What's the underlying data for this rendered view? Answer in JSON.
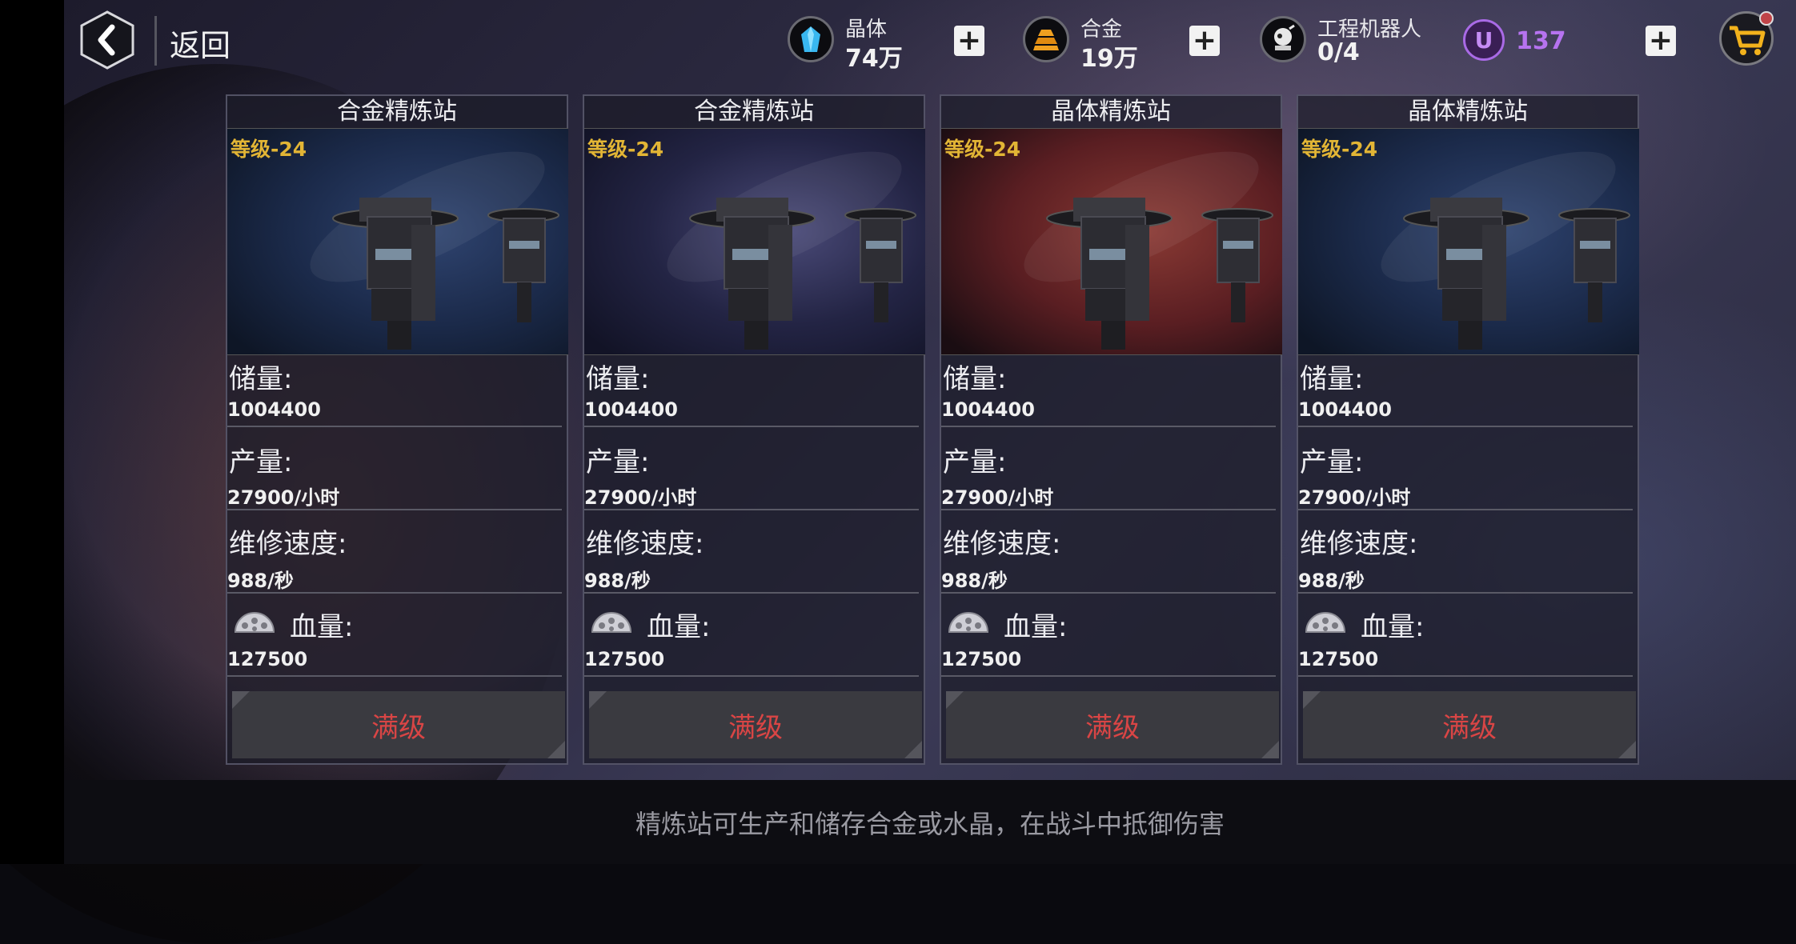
{
  "header": {
    "back_label": "返回",
    "resources": [
      {
        "name": "晶体",
        "value": "74万",
        "icon": "crystal-icon"
      },
      {
        "name": "合金",
        "value": "19万",
        "icon": "alloy-icon"
      },
      {
        "name": "工程机器人",
        "value": "0/4",
        "icon": "robot-icon"
      }
    ],
    "premium": {
      "icon_letter": "U",
      "value": "137"
    }
  },
  "cards": [
    {
      "title": "合金精炼站",
      "level": "等级-24",
      "image_theme": "blue-nebula",
      "storage_label": "储量:",
      "storage_value": "1004400",
      "output_label": "产量:",
      "output_value": "27900/小时",
      "repair_label": "维修速度:",
      "repair_value": "988/秒",
      "hp_label": "血量:",
      "hp_value": "127500",
      "button": "满级"
    },
    {
      "title": "合金精炼站",
      "level": "等级-24",
      "image_theme": "purple-nebula",
      "storage_label": "储量:",
      "storage_value": "1004400",
      "output_label": "产量:",
      "output_value": "27900/小时",
      "repair_label": "维修速度:",
      "repair_value": "988/秒",
      "hp_label": "血量:",
      "hp_value": "127500",
      "button": "满级"
    },
    {
      "title": "晶体精炼站",
      "level": "等级-24",
      "image_theme": "red-nebula",
      "storage_label": "储量:",
      "storage_value": "1004400",
      "output_label": "产量:",
      "output_value": "27900/小时",
      "repair_label": "维修速度:",
      "repair_value": "988/秒",
      "hp_label": "血量:",
      "hp_value": "127500",
      "button": "满级"
    },
    {
      "title": "晶体精炼站",
      "level": "等级-24",
      "image_theme": "blue-nebula",
      "storage_label": "储量:",
      "storage_value": "1004400",
      "output_label": "产量:",
      "output_value": "27900/小时",
      "repair_label": "维修速度:",
      "repair_value": "988/秒",
      "hp_label": "血量:",
      "hp_value": "127500",
      "button": "满级"
    }
  ],
  "footer": {
    "text": "精炼站可生产和储存合金或水晶，在战斗中抵御伤害"
  },
  "colors": {
    "level": "#e2b535",
    "max_button_text": "#d94545",
    "premium": "#b673f0"
  }
}
